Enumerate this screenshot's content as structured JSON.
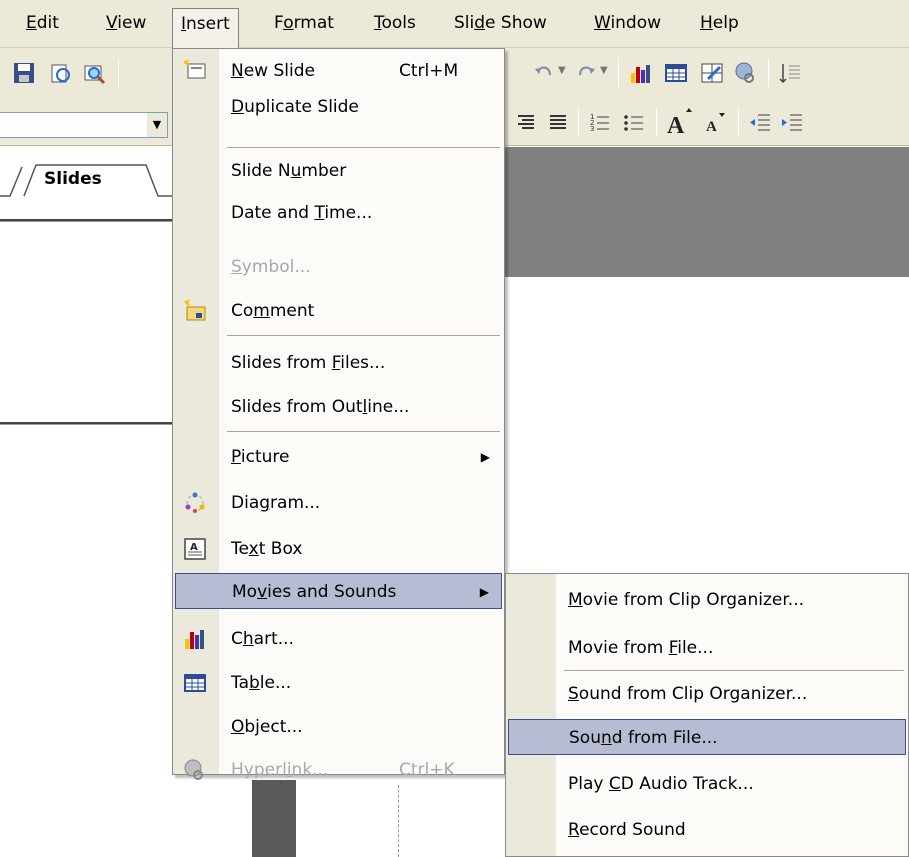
{
  "menubar": {
    "items": [
      {
        "label_pre": "",
        "label_u": "E",
        "label_post": "dit"
      },
      {
        "label_pre": "",
        "label_u": "V",
        "label_post": "iew"
      },
      {
        "label_pre": "",
        "label_u": "I",
        "label_post": "nsert"
      },
      {
        "label_pre": "F",
        "label_u": "o",
        "label_post": "rmat"
      },
      {
        "label_pre": "",
        "label_u": "T",
        "label_post": "ools"
      },
      {
        "label_pre": "Sli",
        "label_u": "d",
        "label_post": "e Show"
      },
      {
        "label_pre": "",
        "label_u": "W",
        "label_post": "indow"
      },
      {
        "label_pre": "",
        "label_u": "H",
        "label_post": "elp"
      }
    ]
  },
  "left_pane": {
    "tab_label": "Slides"
  },
  "insert_menu": {
    "items": [
      {
        "pre": "",
        "u": "N",
        "post": "ew Slide",
        "shortcut": "Ctrl+M",
        "icon": "new-slide-icon"
      },
      {
        "pre": "",
        "u": "D",
        "post": "uplicate Slide"
      },
      {
        "pre": "Slide N",
        "u": "u",
        "post": "mber"
      },
      {
        "pre": "Date and ",
        "u": "T",
        "post": "ime..."
      },
      {
        "pre": "",
        "u": "S",
        "post": "ymbol...",
        "disabled": true
      },
      {
        "pre": "Co",
        "u": "m",
        "post": "ment",
        "icon": "comment-icon"
      },
      {
        "pre": "Slides from ",
        "u": "F",
        "post": "iles..."
      },
      {
        "pre": "Slides from Out",
        "u": "l",
        "post": "ine..."
      },
      {
        "pre": "",
        "u": "P",
        "post": "icture"
      },
      {
        "pre": "Dia",
        "u": "g",
        "post": "ram...",
        "icon": "diagram-icon"
      },
      {
        "pre": "Te",
        "u": "x",
        "post": "t Box",
        "icon": "text-box-icon"
      },
      {
        "pre": "Mo",
        "u": "v",
        "post": "ies and Sounds"
      },
      {
        "pre": "C",
        "u": "h",
        "post": "art...",
        "icon": "chart-icon"
      },
      {
        "pre": "Ta",
        "u": "b",
        "post": "le...",
        "icon": "table-icon"
      },
      {
        "pre": "",
        "u": "O",
        "post": "bject..."
      },
      {
        "pre": "Hyperl",
        "u": "i",
        "post": "nk...",
        "shortcut": "Ctrl+K",
        "disabled": true,
        "icon": "hyperlink-icon"
      }
    ]
  },
  "sub_menu": {
    "items": [
      {
        "pre": "",
        "u": "M",
        "post": "ovie from Clip Organizer..."
      },
      {
        "pre": "Movie from ",
        "u": "F",
        "post": "ile..."
      },
      {
        "pre": "",
        "u": "S",
        "post": "ound from Clip Organizer..."
      },
      {
        "pre": "Sou",
        "u": "n",
        "post": "d from File..."
      },
      {
        "pre": "Play ",
        "u": "C",
        "post": "D Audio Track..."
      },
      {
        "pre": "",
        "u": "R",
        "post": "ecord Sound"
      }
    ]
  },
  "colors": {
    "menu_highlight": "#b7bcd4",
    "highlight_border": "#3d4e8a",
    "chrome": "#ece9d8"
  }
}
